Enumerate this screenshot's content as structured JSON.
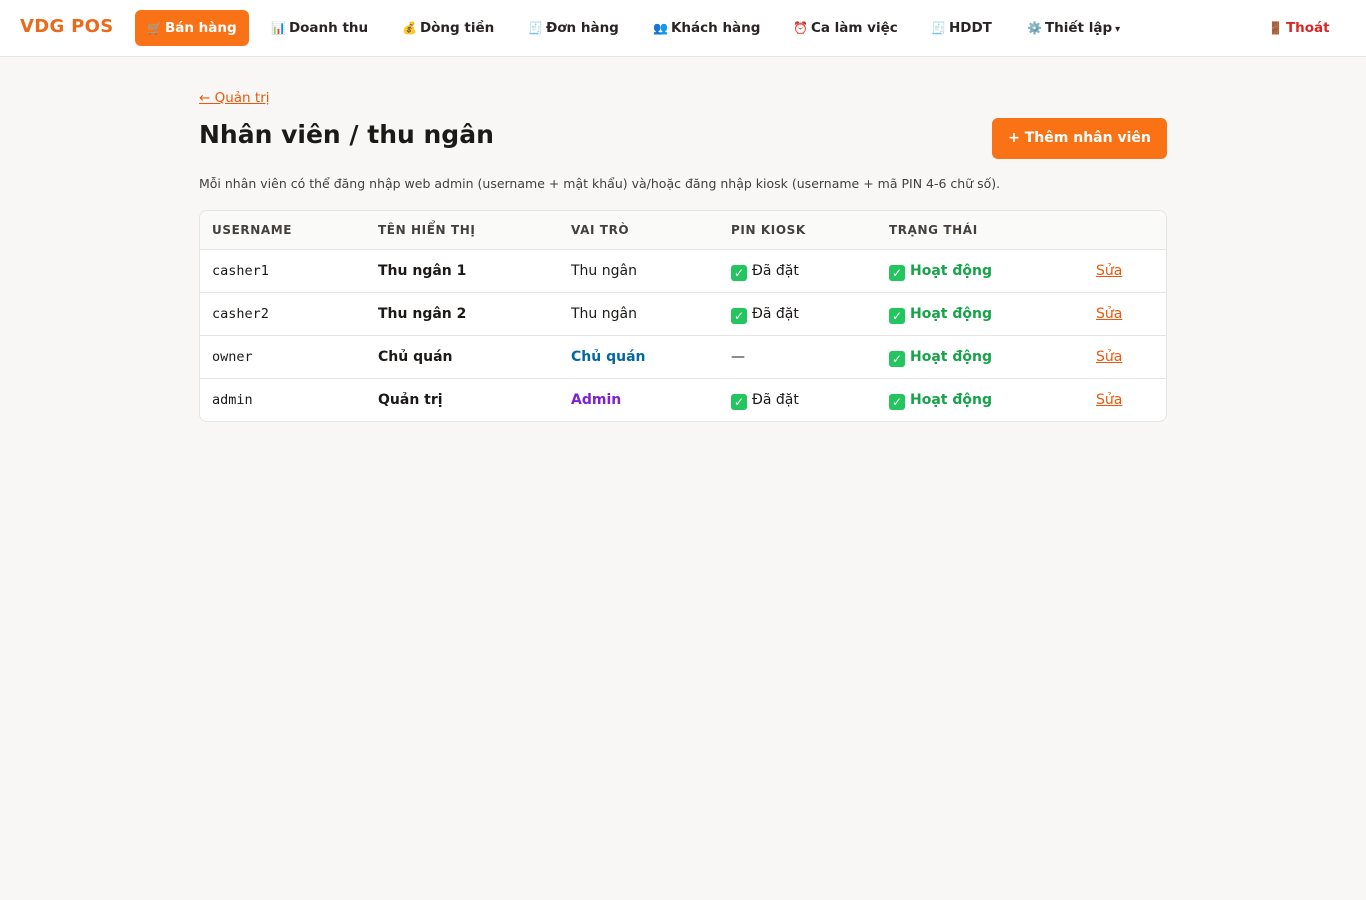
{
  "brand": "VDG POS",
  "nav": {
    "items": [
      {
        "icon": "🛒",
        "label": "Bán hàng"
      },
      {
        "icon": "📊",
        "label": "Doanh thu"
      },
      {
        "icon": "💰",
        "label": "Dòng tiền"
      },
      {
        "icon": "🧾",
        "label": "Đơn hàng"
      },
      {
        "icon": "👥",
        "label": "Khách hàng"
      },
      {
        "icon": "⏰",
        "label": "Ca làm việc"
      },
      {
        "icon": "🧾",
        "label": "HDDT"
      },
      {
        "icon": "⚙️",
        "label": "Thiết lập",
        "caret": "▾"
      }
    ],
    "logout": {
      "icon": "🚪",
      "label": "Thoát"
    }
  },
  "page": {
    "back_link": "← Quản trị",
    "title": "Nhân viên / thu ngân",
    "add_button": "+ Thêm nhân viên",
    "description": "Mỗi nhân viên có thể đăng nhập web admin (username + mật khẩu) và/hoặc đăng nhập kiosk (username + mã PIN 4-6 chữ số)."
  },
  "table": {
    "headers": [
      "USERNAME",
      "TÊN HIỂN THỊ",
      "VAI TRÒ",
      "PIN KIOSK",
      "TRẠNG THÁI"
    ],
    "rows": [
      {
        "username": "casher1",
        "name": "Thu ngân 1",
        "role": "Thu ngân",
        "pin": "Đã đặt",
        "status": "Hoạt động",
        "edit": "Sửa"
      },
      {
        "username": "casher2",
        "name": "Thu ngân 2",
        "role": "Thu ngân",
        "pin": "Đã đặt",
        "status": "Hoạt động",
        "edit": "Sửa"
      },
      {
        "username": "owner",
        "name": "Chủ quán",
        "role": "Chủ quán",
        "pin": "—",
        "status": "Hoạt động",
        "edit": "Sửa"
      },
      {
        "username": "admin",
        "name": "Quản trị",
        "role": "Admin",
        "pin": "Đã đặt",
        "status": "Hoạt động",
        "edit": "Sửa"
      }
    ]
  },
  "colors": {
    "accent": "#f97316",
    "brand": "#ea6a1c",
    "status_active": "#16a34a",
    "role_owner": "#0369a1",
    "role_admin": "#7e22ce",
    "logout": "#dc2626"
  }
}
